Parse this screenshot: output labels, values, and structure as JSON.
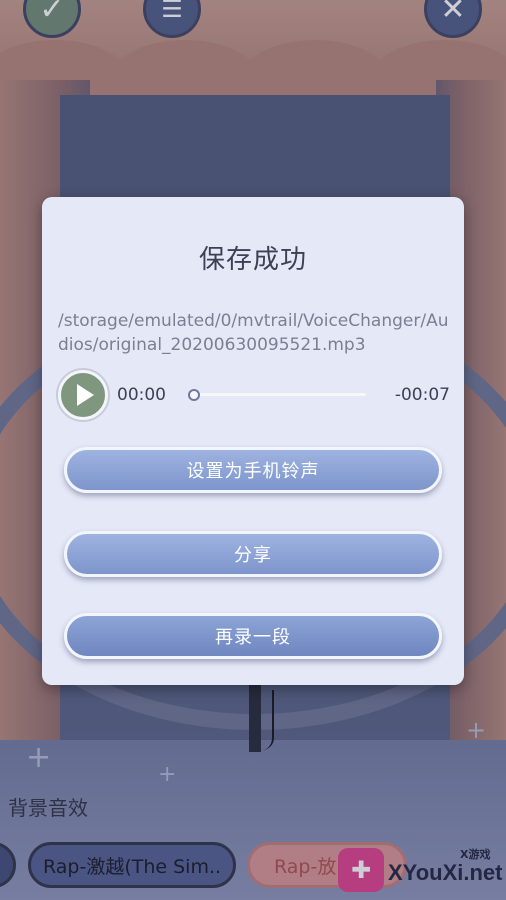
{
  "toolbar": {
    "confirm_icon": "check-icon",
    "list_icon": "list-icon",
    "close_icon": "close-icon"
  },
  "dialog": {
    "title": "保存成功",
    "file_path": "/storage/emulated/0/mvtrail/VoiceChanger/Audios/original_20200630095521.mp3",
    "player": {
      "current_time": "00:00",
      "remaining_time": "-00:07",
      "progress_fraction": 0.0
    },
    "buttons": {
      "set_ringtone": "设置为手机铃声",
      "share": "分享",
      "record_again": "再录一段"
    }
  },
  "background_effects": {
    "label": "背景音效",
    "chips": [
      "Rap-激越(The Sim..",
      "Rap-放"
    ]
  },
  "watermark": {
    "text": "XYouXi.net",
    "small": "X游戏"
  },
  "colors": {
    "dialog_bg": "#e5e8f7",
    "button_blue": "#8aa0d4",
    "play_green": "#7f967f"
  }
}
